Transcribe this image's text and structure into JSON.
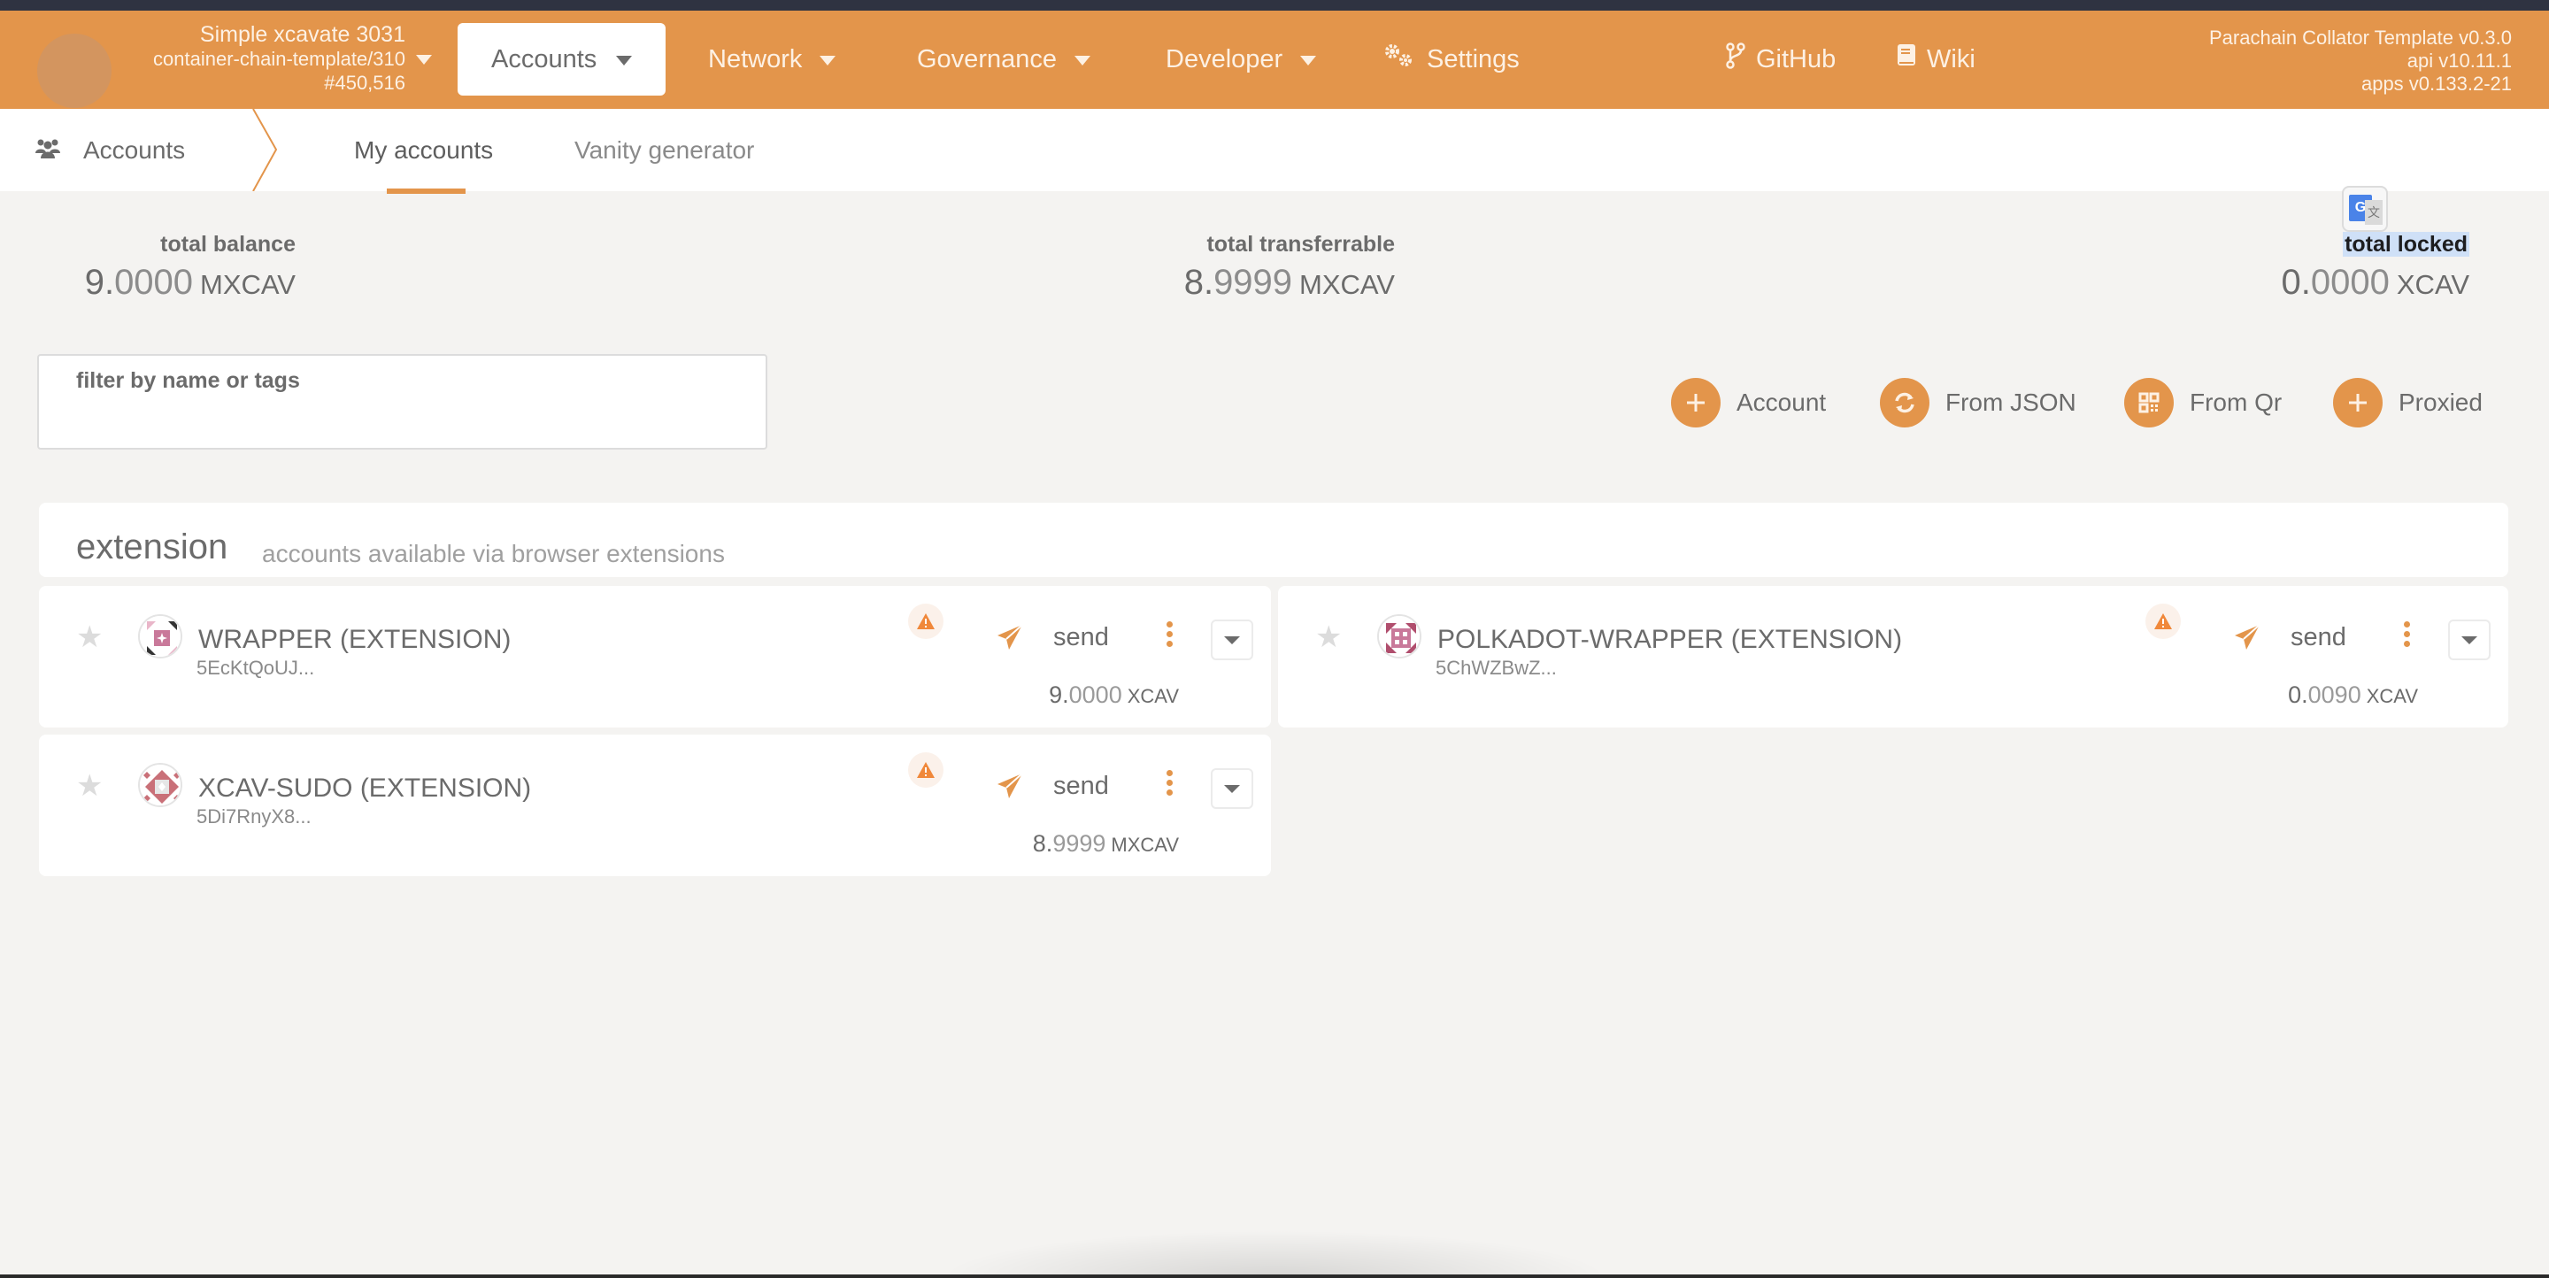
{
  "header": {
    "chain": {
      "name": "Simple xcavate 3031",
      "spec": "container-chain-template/310",
      "block": "#450,516"
    },
    "nav": [
      {
        "label": "Accounts",
        "active": true,
        "has_dropdown": true
      },
      {
        "label": "Network",
        "has_dropdown": true
      },
      {
        "label": "Governance",
        "has_dropdown": true
      },
      {
        "label": "Developer",
        "has_dropdown": true
      },
      {
        "label": "Settings",
        "icon": "gears-icon"
      },
      {
        "label": "GitHub",
        "icon": "code-branch-icon"
      },
      {
        "label": "Wiki",
        "icon": "book-icon"
      }
    ],
    "version": {
      "node": "Parachain Collator Template v0.3.0",
      "api": "api v10.11.1",
      "apps": "apps v0.133.2-21"
    },
    "colors": {
      "accent": "#e3954b",
      "topbar": "#2f3341"
    }
  },
  "subnav": {
    "root_label": "Accounts",
    "root_icon": "users-icon",
    "tabs": [
      {
        "label": "My accounts",
        "active": true
      },
      {
        "label": "Vanity generator",
        "active": false
      }
    ]
  },
  "summary": {
    "total_balance": {
      "label": "total balance",
      "int": "9.",
      "frac": "0000",
      "unit": "MXCAV"
    },
    "total_transferrable": {
      "label": "total transferrable",
      "int": "8.",
      "frac": "9999",
      "unit": "MXCAV"
    },
    "total_locked": {
      "label": "total locked",
      "int": "0.",
      "frac": "0000",
      "unit": "XCAV"
    }
  },
  "filter": {
    "label": "filter by name or tags",
    "value": "",
    "placeholder": ""
  },
  "actions": [
    {
      "label": "Account",
      "icon": "plus-icon"
    },
    {
      "label": "From JSON",
      "icon": "sync-icon"
    },
    {
      "label": "From Qr",
      "icon": "qrcode-icon"
    },
    {
      "label": "Proxied",
      "icon": "plus-icon"
    }
  ],
  "extension_section": {
    "title": "extension",
    "subtitle": "accounts available via browser extensions"
  },
  "accounts": [
    {
      "name": "WRAPPER (EXTENSION)",
      "address": "5EcKtQoUJ...",
      "send_label": "send",
      "balance_int": "9.",
      "balance_frac": "0000",
      "balance_unit": "XCAV",
      "identicon_color": "#c9799a"
    },
    {
      "name": "POLKADOT-WRAPPER (EXTENSION)",
      "address": "5ChWZBwZ...",
      "send_label": "send",
      "balance_int": "0.",
      "balance_frac": "0090",
      "balance_unit": "XCAV",
      "identicon_color": "#b04e6d"
    },
    {
      "name": "XCAV-SUDO (EXTENSION)",
      "address": "5Di7RnyX8...",
      "send_label": "send",
      "balance_int": "8.",
      "balance_frac": "9999",
      "balance_unit": "MXCAV",
      "identicon_color": "#c97078"
    }
  ]
}
